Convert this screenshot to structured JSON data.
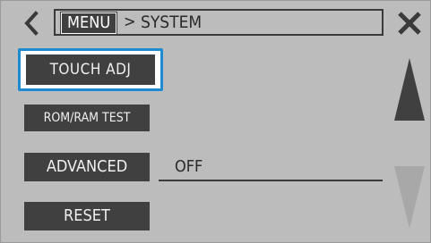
{
  "header": {
    "back_icon": "chevron-left-icon",
    "breadcrumb": {
      "root": "MENU",
      "separator": ">",
      "current": "SYSTEM"
    },
    "close_icon": "close-icon"
  },
  "buttons": {
    "touch_adj": "TOUCH ADJ",
    "rom_ram_test": "ROM/RAM TEST",
    "advanced": "ADVANCED",
    "reset": "RESET"
  },
  "advanced_value": "OFF",
  "scroll": {
    "up_icon": "scroll-up-triangle-icon",
    "down_icon": "scroll-down-triangle-icon",
    "up_enabled": true,
    "down_enabled": false
  },
  "colors": {
    "background": "#bcbcbc",
    "button": "#404040",
    "button_text": "#f0f0f0",
    "focus": "#1e8ad0",
    "disabled_arrow": "#a8a8a8"
  },
  "focused_item": "touch_adj"
}
